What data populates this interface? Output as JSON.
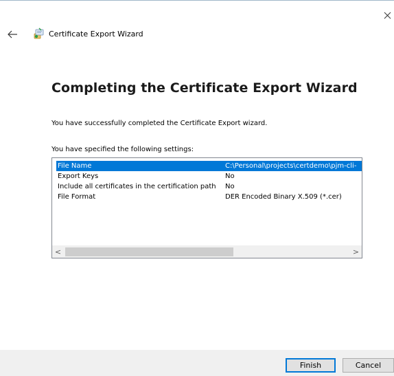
{
  "window": {
    "title": "Certificate Export Wizard"
  },
  "page": {
    "heading": "Completing the Certificate Export Wizard",
    "success_text": "You have successfully completed the Certificate Export wizard.",
    "settings_label": "You have specified the following settings:"
  },
  "settings": [
    {
      "name": "File Name",
      "value": "C:\\Personal\\projects\\certdemo\\pjm-cli-",
      "selected": true
    },
    {
      "name": "Export Keys",
      "value": "No",
      "selected": false
    },
    {
      "name": "Include all certificates in the certification path",
      "value": "No",
      "selected": false
    },
    {
      "name": "File Format",
      "value": "DER Encoded Binary X.509 (*.cer)",
      "selected": false
    }
  ],
  "scrollbar": {
    "left_arrow": "<",
    "right_arrow": ">"
  },
  "buttons": {
    "finish": "Finish",
    "cancel": "Cancel"
  },
  "icons": {
    "close": "close-icon",
    "back": "back-arrow-icon",
    "wizard": "certificate-icon"
  },
  "colors": {
    "selection": "#0078d7",
    "footer_bg": "#f0f0f0"
  }
}
